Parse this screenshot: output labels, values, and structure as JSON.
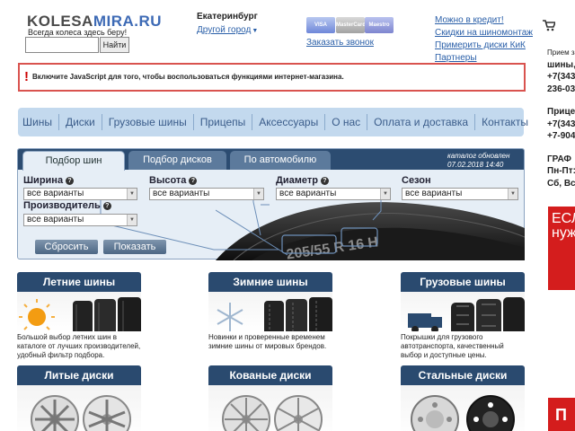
{
  "header": {
    "logo_part1": "KOLESA",
    "logo_part2": "MIRA.RU",
    "slogan": "Всегда колеса здесь беру!",
    "search_placeholder": "",
    "search_button": "Найти",
    "city": "Екатеринбург",
    "other_city": "Другой город",
    "cards": [
      "VISA",
      "MasterCard",
      "Maestro"
    ],
    "order_call": "Заказать звонок",
    "right_links": [
      "Можно в кредит!",
      "Скидки на шиномонтаж",
      "Примерить диски КиК",
      "Партнеры"
    ]
  },
  "right_column": {
    "reception_label": "Прием за",
    "lines": [
      "шины,",
      "+7(343",
      "236-03",
      "",
      "Прице",
      "+7(343",
      "+7-904",
      "",
      "ГРАФ",
      "Пн-Пт:",
      "Сб, Вс"
    ],
    "ad1_text": "ЕСЛ нуж",
    "ad2_text": "П"
  },
  "warning": {
    "text": "Включите JavaScript для того, чтобы воспользоваться функциями интернет-магазина."
  },
  "nav": [
    "Шины",
    "Диски",
    "Грузовые шины",
    "Прицепы",
    "Аксессуары",
    "О нас",
    "Оплата и доставка",
    "Контакты"
  ],
  "selector": {
    "tabs": [
      "Подбор шин",
      "Подбор дисков",
      "По автомобилю"
    ],
    "catalog_updated_label": "каталог обновлен",
    "catalog_updated_date": "07.02.2018 14:40",
    "fields": {
      "width": {
        "label": "Ширина",
        "value": "все варианты"
      },
      "height": {
        "label": "Высота",
        "value": "все варианты"
      },
      "diameter": {
        "label": "Диаметр",
        "value": "все варианты"
      },
      "season": {
        "label": "Сезон",
        "value": "все варианты"
      },
      "maker": {
        "label": "Производитель",
        "value": "все варианты"
      }
    },
    "reset_button": "Сбросить",
    "show_button": "Показать",
    "tire_marking": "205/55 R 16 H"
  },
  "categories": [
    {
      "title": "Летние шины",
      "desc": "Большой выбор летних шин в каталоге от лучших производителей, удобный фильтр подбора."
    },
    {
      "title": "Зимние шины",
      "desc": "Новинки и проверенные временем зимние шины от мировых брендов."
    },
    {
      "title": "Грузовые шины",
      "desc": "Покрышки для грузового автотранспорта, качественный выбор и доступные цены."
    },
    {
      "title": "Литые диски",
      "desc": ""
    },
    {
      "title": "Кованые диски",
      "desc": ""
    },
    {
      "title": "Стальные диски",
      "desc": ""
    }
  ],
  "colors": {
    "link": "#2a5fa8",
    "nav_bg": "#c3d9ee",
    "panel_header": "#2c4c71",
    "category_header": "#2a4a6f",
    "warning_border": "#d9534f",
    "ad_red": "#d41d1d"
  }
}
